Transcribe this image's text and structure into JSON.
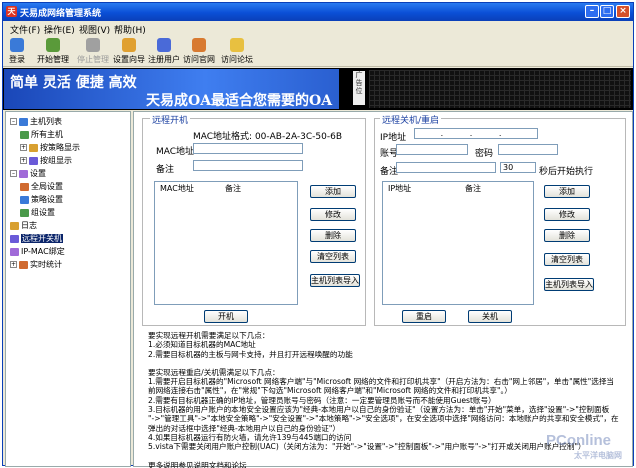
{
  "window": {
    "title": "天易成网络管理系统",
    "min": "–",
    "max": "□",
    "close": "×",
    "logo": "天"
  },
  "menu": [
    "文件(F)",
    "操作(E)",
    "视图(V)",
    "帮助(H)"
  ],
  "toolbar": [
    {
      "label": "登录",
      "disabled": false,
      "color": "#3a7ad8"
    },
    {
      "label": "开始管理",
      "disabled": false,
      "color": "#5a9a3a"
    },
    {
      "label": "停止管理",
      "disabled": true,
      "color": "#a0a0a0"
    },
    {
      "label": "设置向导",
      "disabled": false,
      "color": "#e0a030"
    },
    {
      "label": "注册用户",
      "disabled": false,
      "color": "#4a6ad8"
    },
    {
      "label": "访问官网",
      "disabled": false,
      "color": "#d87a30"
    },
    {
      "label": "访问论坛",
      "disabled": false,
      "color": "#e8c040"
    }
  ],
  "banner": {
    "line1": "简单 灵活 便捷 高效",
    "line2": "天易成OA最适合您需要的OA",
    "ad": "广告位"
  },
  "tree": [
    {
      "label": "主机列表",
      "level": 0,
      "expander": "–"
    },
    {
      "label": "所有主机",
      "level": 1
    },
    {
      "label": "按策略显示",
      "level": 1,
      "expander": "+"
    },
    {
      "label": "按组显示",
      "level": 1,
      "expander": "+"
    },
    {
      "label": "设置",
      "level": 0,
      "expander": "–"
    },
    {
      "label": "全局设置",
      "level": 1
    },
    {
      "label": "策略设置",
      "level": 1
    },
    {
      "label": "组设置",
      "level": 1
    },
    {
      "label": "日志",
      "level": 0
    },
    {
      "label": "远程开关机",
      "level": 0,
      "selected": true
    },
    {
      "label": "IP-MAC绑定",
      "level": 0
    },
    {
      "label": "实时统计",
      "level": 0,
      "expander": "+"
    }
  ],
  "wake": {
    "group": "远程开机",
    "mac_format": "MAC地址格式: 00-AB-2A-3C-50-6B",
    "mac_label": "MAC地址",
    "mac_value": "",
    "note_label": "备注",
    "note_value": "",
    "columns": [
      "MAC地址",
      "备注"
    ],
    "buttons": {
      "add": "添加",
      "edit": "修改",
      "delete": "删除",
      "clear": "清空列表",
      "import": "主机列表导入"
    },
    "power_on": "开机"
  },
  "shutdown": {
    "group": "远程关机/重启",
    "ip_label": "IP地址",
    "ip_value": ". . .",
    "account_label": "账号",
    "account_value": "",
    "password_label": "密码",
    "password_value": "",
    "note_label": "备注",
    "note_value": "",
    "delay_value": "30",
    "delay_suffix": "秒后开始执行",
    "columns": [
      "IP地址",
      "备注"
    ],
    "buttons": {
      "add": "添加",
      "edit": "修改",
      "delete": "删除",
      "clear": "清空列表",
      "import": "主机列表导入"
    },
    "restart": "重启",
    "shutdown": "关机"
  },
  "notes": [
    "要实现远程开机需要满足以下几点：",
    "1.必须知道目标机器的MAC地址",
    "2.需要目标机器的主板与网卡支持，并且打开远程唤醒的功能",
    "",
    "要实现远程重启/关机需满足以下几点：",
    "1.需要开启目标机器的\"Microsoft 网络客户端\"与\"Microsoft 网络的文件和打印机共享\"（开启方法为：右击\"网上邻居\"，单击\"属性\"选择当",
    "前网络连接右击\"属性\"，在\"常规\"下勾选\"Microsoft 网络客户端\"和\"Microsoft 网络的文件和打印机共享\"。）",
    "2.需要有目标机器正确的IP地址，管理员账号与密码（注意：一定要管理员账号而不能使用Guest账号）",
    "3.目标机器的用户账户的本地安全设置应该为\"经典-本地用户以自己的身份验证\"（设置方法为：单击\"开始\"菜单，选择\"设置\"->\"控制面板",
    "\"->\"管理工具\"->\"本地安全策略\"->\"安全设置\"->\"本地策略\"->\"安全选项\"，在安全选项中选择\"网络访问：本地账户的共享和安全模式\"，在",
    "弹出的对话框中选择\"经典-本地用户以自己的身份验证\"）",
    "4.如果目标机器运行有防火墙，请允许139与445端口的访问",
    "5.vista下需要关闭用户账户控制(UAC)（关闭方法为：\"开始\"->\"设置\"->\"控制面板\"->\"用户账号\"->\"打开或关闭用户账户控制\"）",
    "",
    "更多说明参见说明文档和论坛"
  ],
  "watermark": {
    "text": "PConline",
    "sub": "太平洋电脑网"
  }
}
